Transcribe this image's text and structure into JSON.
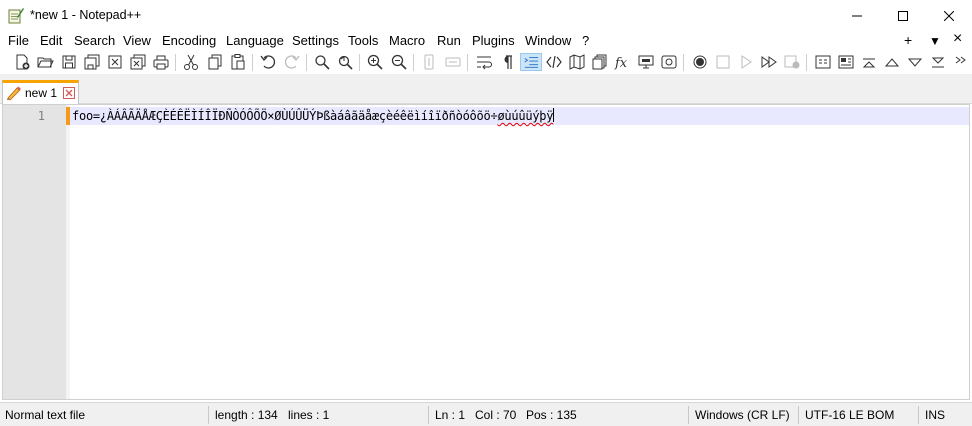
{
  "window": {
    "title": "*new 1 - Notepad++"
  },
  "menu": {
    "items": [
      "File",
      "Edit",
      "Search",
      "View",
      "Encoding",
      "Language",
      "Settings",
      "Tools",
      "Macro",
      "Run",
      "Plugins",
      "Window",
      "?"
    ],
    "right_controls": [
      "+",
      "▼",
      "×"
    ]
  },
  "toolbar": {
    "icons": [
      "new-file",
      "open-file",
      "save",
      "save-all",
      "close",
      "close-all",
      "print",
      "cut",
      "copy",
      "paste",
      "undo",
      "redo",
      "find",
      "replace",
      "zoom-in",
      "zoom-out",
      "sync-vertical",
      "sync-horizontal",
      "word-wrap",
      "show-all-characters",
      "indent-guide",
      "user-defined-language",
      "document-map",
      "clipboard-history",
      "function-list",
      "monitoring",
      "panel",
      "record-macro",
      "stop-recording",
      "playback-macro",
      "run-macro-multiple",
      "save-macro",
      "overflow"
    ],
    "active": "indent-guide"
  },
  "tabs": [
    {
      "label": "new 1",
      "modified": true
    }
  ],
  "editor": {
    "line_number": "1",
    "text_main": "foo=¿ÀÁÂÃÄÅÆÇÈÉÊËÌÍÎÏÐÑÒÓÔÕÖ×ØÙÚÛÜÝÞßàáâãäåæçèéêëìíîïðñòóôõö÷",
    "text_marked": "øùúûüýþÿ",
    "current_line_color": "#e8e8ff",
    "gutter_color": "#e4e4e4",
    "change_marker_color": "#f59a1b"
  },
  "status": {
    "file_type": "Normal text file",
    "length": "length : 134",
    "lines": "lines : 1",
    "ln": "Ln : 1",
    "col": "Col : 70",
    "pos": "Pos : 135",
    "eol": "Windows (CR LF)",
    "encoding": "UTF-16 LE BOM",
    "mode": "INS"
  }
}
